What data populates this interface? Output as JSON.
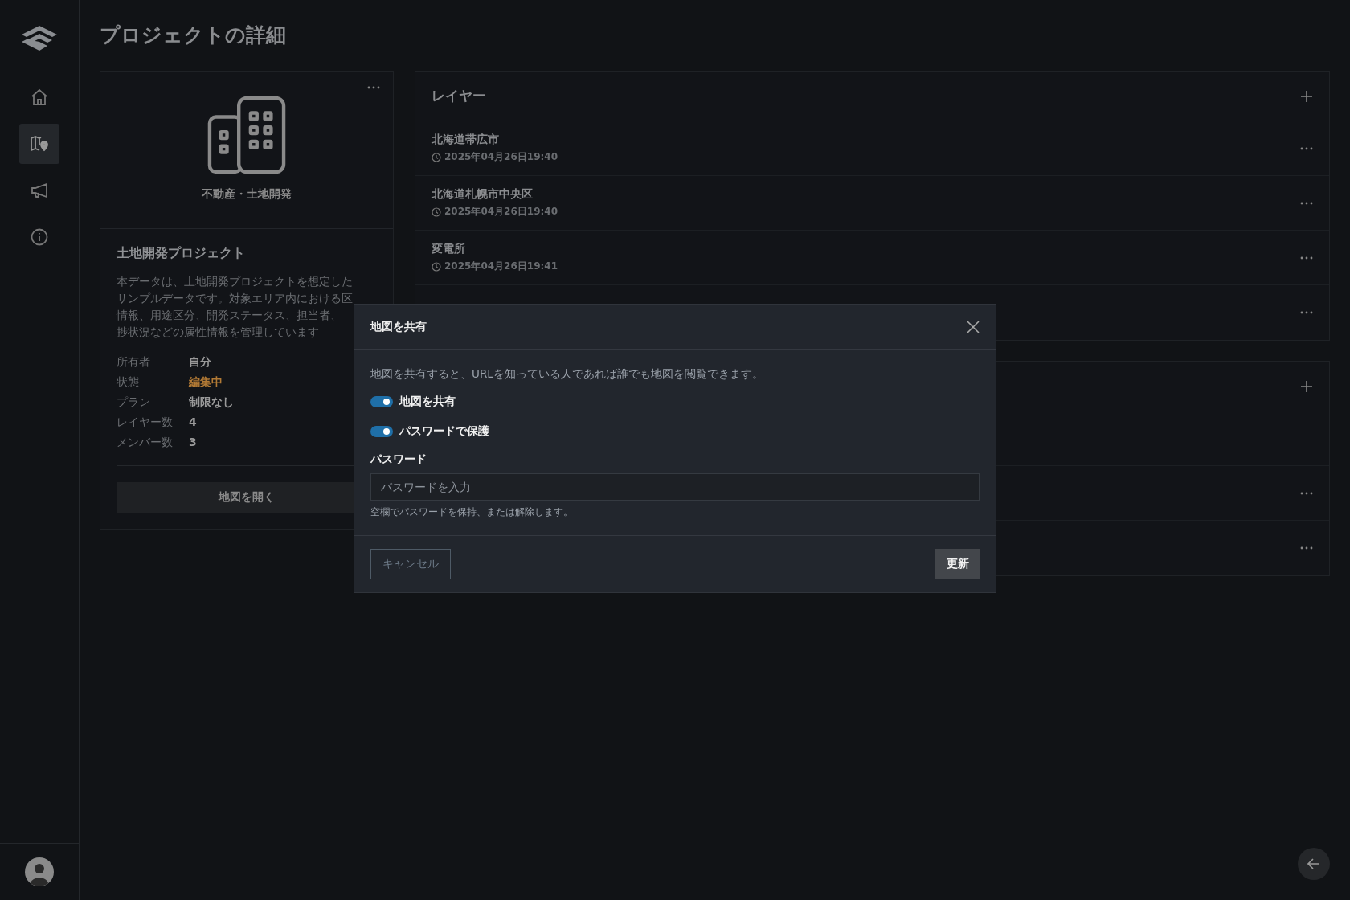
{
  "page_title": "プロジェクトの詳細",
  "sidebar": {
    "items": [
      {
        "selected": false
      },
      {
        "selected": true
      },
      {
        "selected": false
      },
      {
        "selected": false
      }
    ]
  },
  "project_card": {
    "category": "不動産・土地開発",
    "name": "土地開発プロジェクト",
    "description_lines": [
      "本データは、土地開発プロジェクトを想定した",
      "サンプルデータです。対象エリア内における区",
      "情報、用途区分、開発ステータス、担当者、",
      "捗状況などの属性情報を管理しています"
    ],
    "details": [
      {
        "label": "所有者",
        "value": "自分",
        "kind": "plain"
      },
      {
        "label": "状態",
        "value": "編集中",
        "kind": "status"
      },
      {
        "label": "プラン",
        "value": "制限なし",
        "kind": "plain"
      },
      {
        "label": "レイヤー数",
        "value": "4",
        "kind": "plain"
      },
      {
        "label": "メンバー数",
        "value": "3",
        "kind": "plain"
      }
    ],
    "open_button": "地図を開く"
  },
  "layers": {
    "title": "レイヤー",
    "items": [
      {
        "kind": "entry",
        "name": "北海道帯広市",
        "time": "2025年04月26日19:40"
      },
      {
        "kind": "entry",
        "name": "北海道札幌市中央区",
        "time": "2025年04月26日19:40"
      },
      {
        "kind": "entry",
        "name": "変電所",
        "time": "2025年04月26日19:41"
      },
      {
        "kind": "covered"
      }
    ]
  },
  "second_panel": {
    "rows": [
      {
        "menu": false
      },
      {
        "menu": true
      },
      {
        "menu": true
      }
    ]
  },
  "dialog": {
    "title": "地図を共有",
    "description": "地図を共有すると、URLを知っている人であれば誰でも地図を閲覧できます。",
    "toggles": [
      {
        "label": "地図を共有",
        "checked": true
      },
      {
        "label": "パスワードで保護",
        "checked": true
      }
    ],
    "password_label": "パスワード",
    "password_placeholder": "パスワードを入力",
    "password_hint": "空欄でパスワードを保持、または解除します。",
    "cancel": "キャンセル",
    "submit": "更新"
  }
}
